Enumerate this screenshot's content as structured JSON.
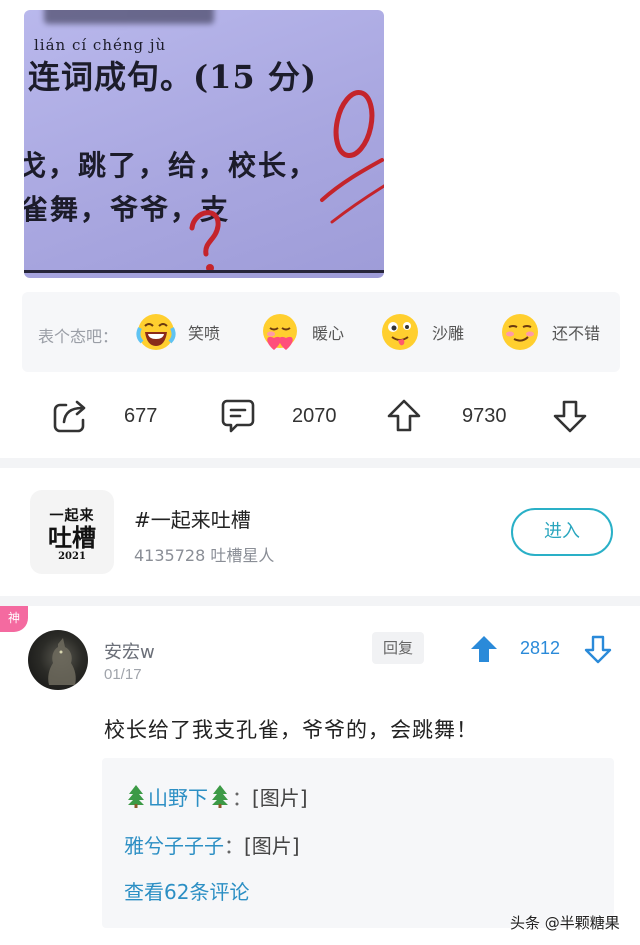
{
  "post_image": {
    "pinyin": "lián cí chéng jù",
    "heading": "连词成句。(15 分)",
    "line1": "戈，跳了，给，校长，",
    "line2": "雀舞，爷爷，支",
    "score_mark": "0",
    "question_mark": "?"
  },
  "reactions": {
    "prompt": "表个态吧：",
    "items": [
      {
        "label": "笑喷",
        "icon": "laughing-crying-emoji-icon"
      },
      {
        "label": "暖心",
        "icon": "heart-hug-emoji-icon"
      },
      {
        "label": "沙雕",
        "icon": "silly-tongue-emoji-icon"
      },
      {
        "label": "还不错",
        "icon": "content-smile-emoji-icon"
      }
    ]
  },
  "actions": {
    "share_count": "677",
    "comment_count": "2070",
    "upvote_count": "9730"
  },
  "topic": {
    "logo_line1": "一起来",
    "logo_line2": "吐槽",
    "logo_line3": "2021",
    "title": "#一起来吐槽",
    "subtitle": "4135728 吐槽星人",
    "enter_label": "进入"
  },
  "comment": {
    "badge": "神",
    "username": "安宏w",
    "date": "01/17",
    "reply_label": "回复",
    "upvotes": "2812",
    "text": "校长给了我支孔雀，爷爷的，会跳舞！",
    "replies": [
      {
        "user": "山野下",
        "sep": "：",
        "body": "[图片]"
      },
      {
        "user": "雅兮子子子",
        "sep": "：",
        "body": "[图片]"
      }
    ],
    "view_more": "查看62条评论"
  },
  "colors": {
    "accent_blue": "#2a8ad9",
    "topic_teal": "#2ab0c7",
    "badge_pink": "#f46aa0"
  },
  "watermark": "头条 @半颗糖果"
}
